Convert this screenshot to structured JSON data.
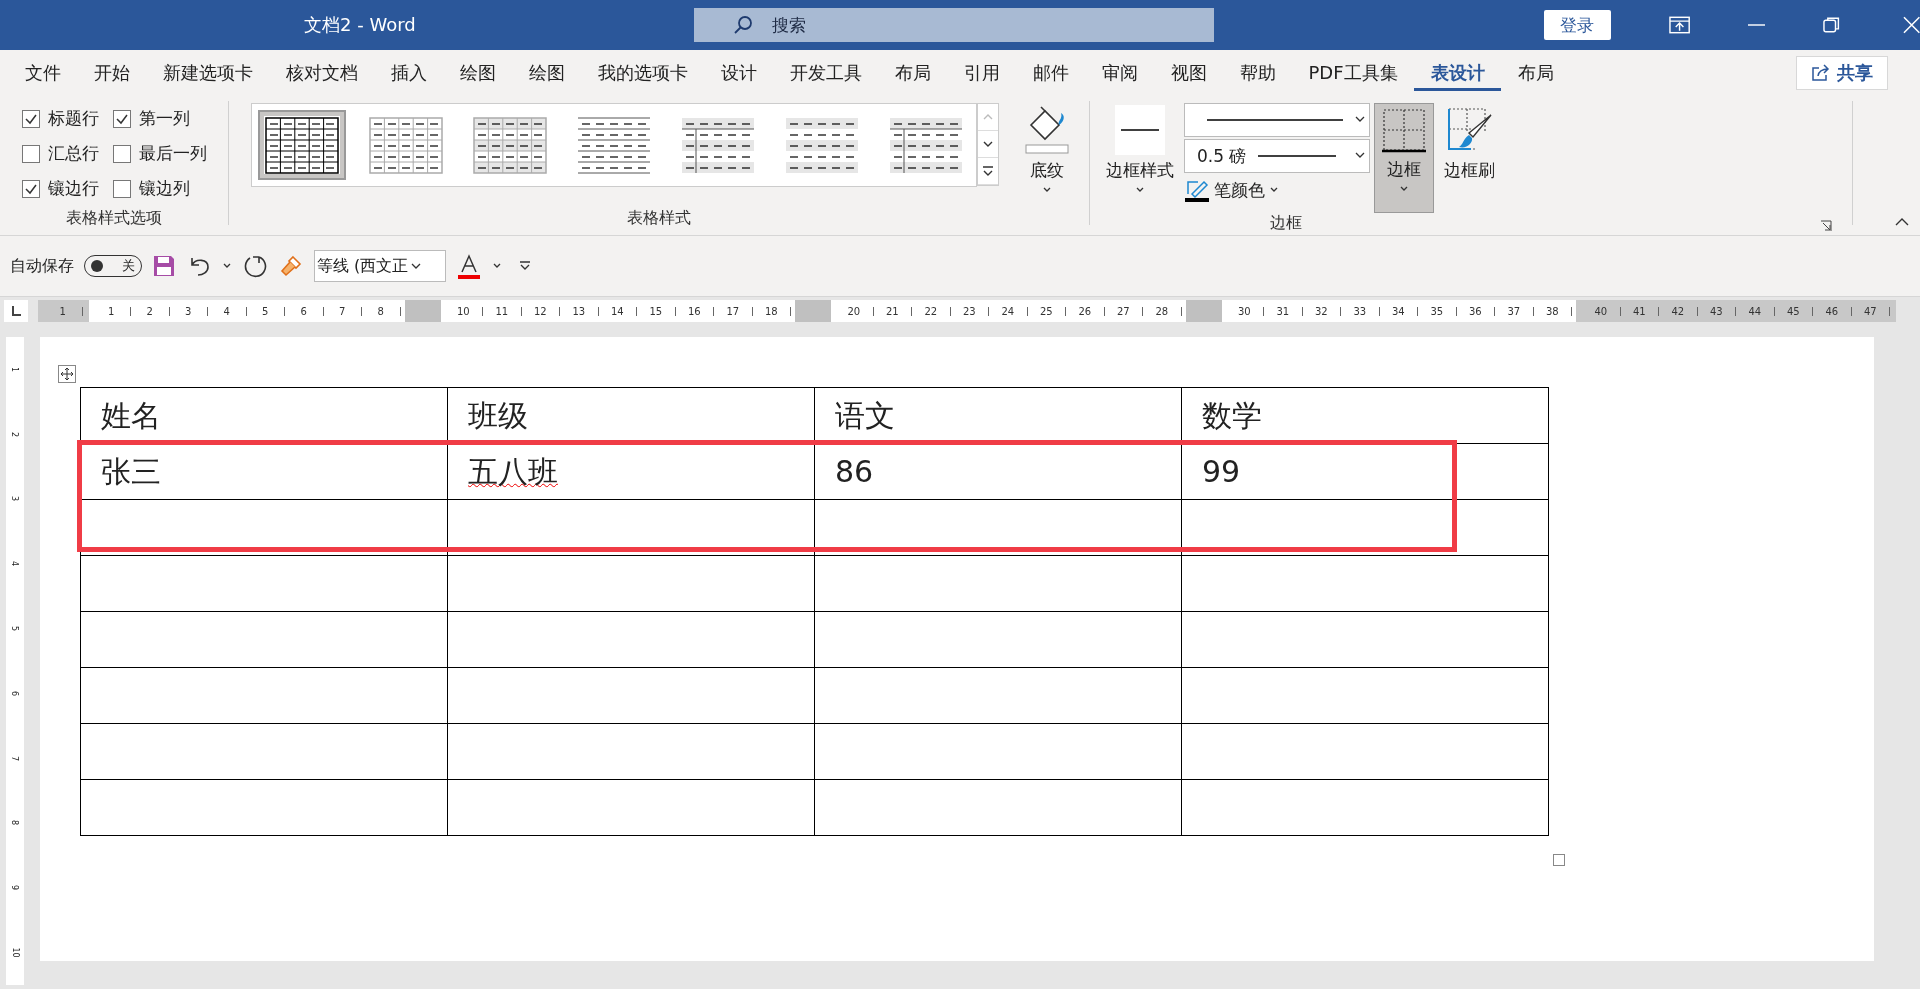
{
  "window": {
    "title": "文档2  -  Word",
    "search_placeholder": "搜索",
    "signin": "登录"
  },
  "tabs": [
    {
      "label": "文件",
      "selected": false
    },
    {
      "label": "开始",
      "selected": false
    },
    {
      "label": "新建选项卡",
      "selected": false
    },
    {
      "label": "核对文档",
      "selected": false
    },
    {
      "label": "插入",
      "selected": false
    },
    {
      "label": "绘图",
      "selected": false
    },
    {
      "label": "绘图",
      "selected": false
    },
    {
      "label": "我的选项卡",
      "selected": false
    },
    {
      "label": "设计",
      "selected": false
    },
    {
      "label": "开发工具",
      "selected": false
    },
    {
      "label": "布局",
      "selected": false
    },
    {
      "label": "引用",
      "selected": false
    },
    {
      "label": "邮件",
      "selected": false
    },
    {
      "label": "审阅",
      "selected": false
    },
    {
      "label": "视图",
      "selected": false
    },
    {
      "label": "帮助",
      "selected": false
    },
    {
      "label": "PDF工具集",
      "selected": false
    },
    {
      "label": "表设计",
      "selected": true
    },
    {
      "label": "布局",
      "selected": false
    }
  ],
  "share": "共享",
  "ribbon": {
    "style_options": {
      "label": "表格样式选项",
      "checkboxes": [
        {
          "label": "标题行",
          "checked": true
        },
        {
          "label": "第一列",
          "checked": true
        },
        {
          "label": "汇总行",
          "checked": false
        },
        {
          "label": "最后一列",
          "checked": false
        },
        {
          "label": "镶边行",
          "checked": true
        },
        {
          "label": "镶边列",
          "checked": false
        }
      ]
    },
    "table_styles": {
      "label": "表格样式",
      "styles": [
        {
          "kind": "grid",
          "selected": true
        },
        {
          "kind": "light-grid",
          "selected": false
        },
        {
          "kind": "banded-grid",
          "selected": false
        },
        {
          "kind": "lines",
          "selected": false
        },
        {
          "kind": "first-column",
          "selected": false
        },
        {
          "kind": "banded",
          "selected": false
        },
        {
          "kind": "first-column",
          "selected": false
        }
      ],
      "shading": "底纹"
    },
    "borders": {
      "label": "边框",
      "border_styles": "边框样式",
      "weight": "0.5 磅",
      "pen_color": "笔颜色",
      "borders": "边框",
      "borders_pressed": true,
      "border_painter": "边框刷"
    }
  },
  "quick_access": {
    "autosave": "自动保存",
    "autosave_on": false,
    "autosave_state": "关",
    "font": "等线 (西文正"
  },
  "ruler": {
    "segments": [
      {
        "kind": "margin",
        "labels": [
          "1"
        ]
      },
      {
        "kind": "text",
        "labels": [
          "1",
          "2",
          "3",
          "4",
          "5",
          "6",
          "7",
          "8"
        ]
      },
      {
        "kind": "column"
      },
      {
        "kind": "text",
        "labels": [
          "10",
          "11",
          "12",
          "13",
          "14",
          "15",
          "16",
          "17",
          "18"
        ]
      },
      {
        "kind": "column"
      },
      {
        "kind": "text",
        "labels": [
          "20",
          "21",
          "22",
          "23",
          "24",
          "25",
          "26",
          "27",
          "28"
        ]
      },
      {
        "kind": "column"
      },
      {
        "kind": "text",
        "labels": [
          "30",
          "31",
          "32",
          "33",
          "34",
          "35",
          "36",
          "37",
          "38"
        ]
      },
      {
        "kind": "margin",
        "labels": [
          "40",
          "41",
          "42",
          "43",
          "44",
          "45",
          "46",
          "47"
        ]
      }
    ],
    "vertical_labels": [
      "1",
      "2",
      "3",
      "4",
      "5",
      "6",
      "7",
      "8",
      "9",
      "10"
    ]
  },
  "table": {
    "rows": [
      [
        {
          "text": "姓名"
        },
        {
          "text": "班级"
        },
        {
          "text": "语文"
        },
        {
          "text": "数学"
        }
      ],
      [
        {
          "text": "张三"
        },
        {
          "text": "五八班",
          "misspelled": true
        },
        {
          "text": "86"
        },
        {
          "text": "99"
        }
      ],
      [],
      [],
      [],
      [],
      [],
      []
    ]
  }
}
